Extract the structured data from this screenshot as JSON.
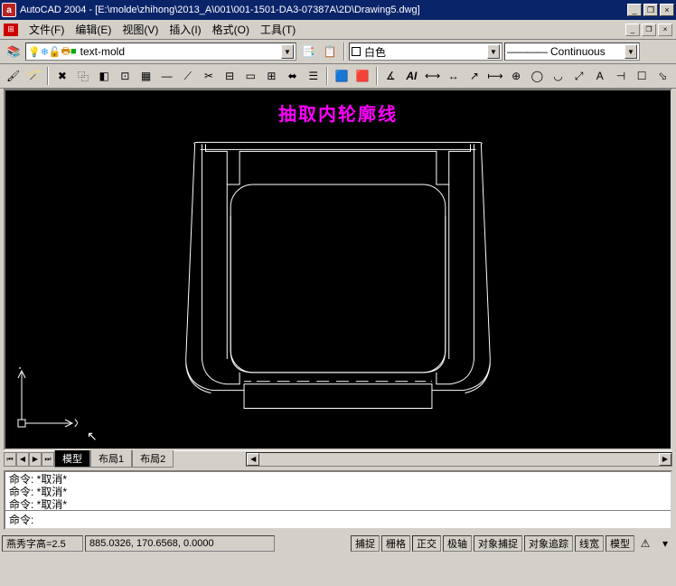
{
  "title": "AutoCAD 2004 - [E:\\molde\\zhihong\\2013_A\\001\\001-1501-DA3-07387A\\2D\\Drawing5.dwg]",
  "menu": {
    "file": "文件(F)",
    "edit": "编辑(E)",
    "view": "视图(V)",
    "insert": "插入(I)",
    "format": "格式(O)",
    "tools": "工具(T)"
  },
  "layer": {
    "current": "text-mold"
  },
  "color": {
    "current": "白色"
  },
  "linetype": {
    "current": "Continuous"
  },
  "drawing_label": "抽取内轮廓线",
  "ucs": {
    "x": "X",
    "y": "Y"
  },
  "tabs": {
    "model": "模型",
    "layout1": "布局1",
    "layout2": "布局2"
  },
  "cmd": {
    "line1": "命令:  *取消*",
    "line2": "命令:  *取消*",
    "line3": "命令:  *取消*",
    "prompt": "命令:"
  },
  "status": {
    "left": "燕秀字高=2.5",
    "coord": "885.0326, 170.6568, 0.0000",
    "snap": "捕捉",
    "grid": "栅格",
    "ortho": "正交",
    "polar": "极轴",
    "osnap": "对象捕捉",
    "otrack": "对象追踪",
    "lwt": "线宽",
    "model": "模型"
  }
}
